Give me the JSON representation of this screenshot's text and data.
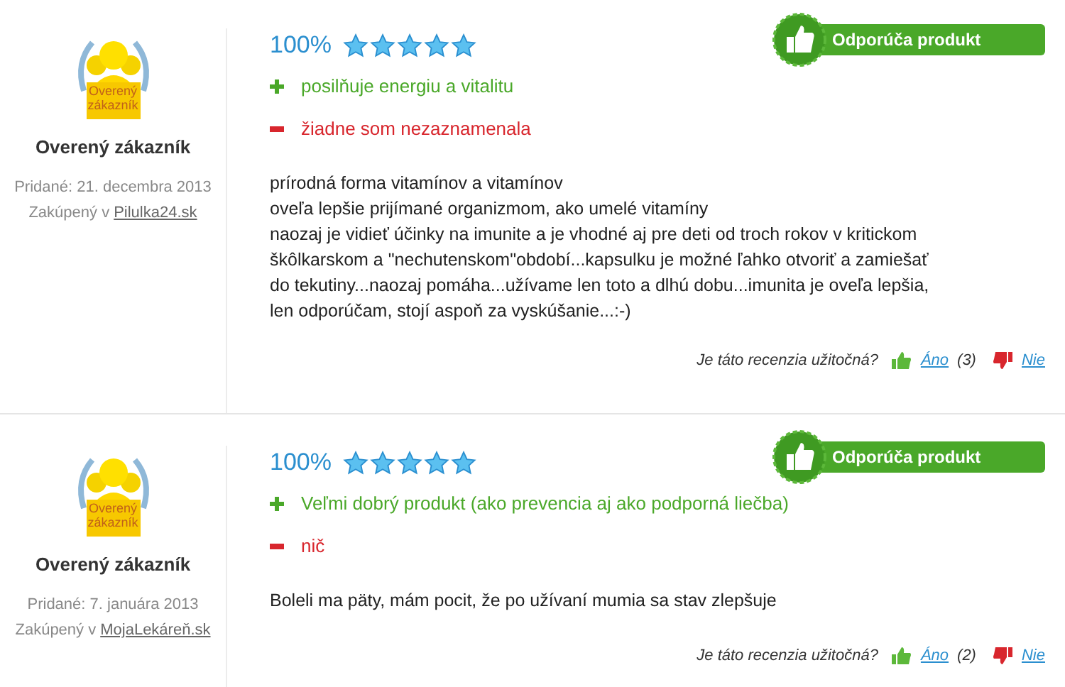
{
  "reviews": [
    {
      "badge_label": "Overený zákazník",
      "reviewer": "Overený zákazník",
      "added": "Pridané: 21. decembra 2013",
      "purchased_prefix": "Zakúpený v",
      "shop": "Pilulka24.sk",
      "percent": "100%",
      "stars": 5,
      "recommend": "Odporúča produkt",
      "pros": "posilňuje energiu a vitalitu",
      "cons": "žiadne som nezaznamenala",
      "body": [
        "prírodná forma vitamínov a vitamínov",
        "oveľa lepšie prijímané organizmom, ako umelé vitamíny",
        "naozaj je vidieť účinky na imunite a je vhodné aj pre deti od troch rokov v kritickom škôlkarskom a \"nechutenskom\"období...kapsulku je možné ľahko otvoriť a zamiešať do tekutiny...naozaj pomáha...užívame len toto a dlhú dobu...imunita je oveľa lepšia, len odporúčam, stojí aspoň za vyskúšanie...:-)"
      ],
      "helpful_question": "Je táto recenzia užitočná?",
      "yes": "Áno",
      "yes_count": "(3)",
      "no": "Nie"
    },
    {
      "badge_label": "Overený zákazník",
      "reviewer": "Overený zákazník",
      "added": "Pridané: 7. januára 2013",
      "purchased_prefix": "Zakúpený v",
      "shop": "MojaLekáreň.sk",
      "percent": "100%",
      "stars": 5,
      "recommend": "Odporúča produkt",
      "pros": "Veľmi dobrý produkt (ako prevencia aj ako podporná liečba)",
      "cons": "nič",
      "body": [
        "Boleli ma päty, mám pocit, že po užívaní mumia sa stav zlepšuje"
      ],
      "helpful_question": "Je táto recenzia užitočná?",
      "yes": "Áno",
      "yes_count": "(2)",
      "no": "Nie"
    }
  ]
}
